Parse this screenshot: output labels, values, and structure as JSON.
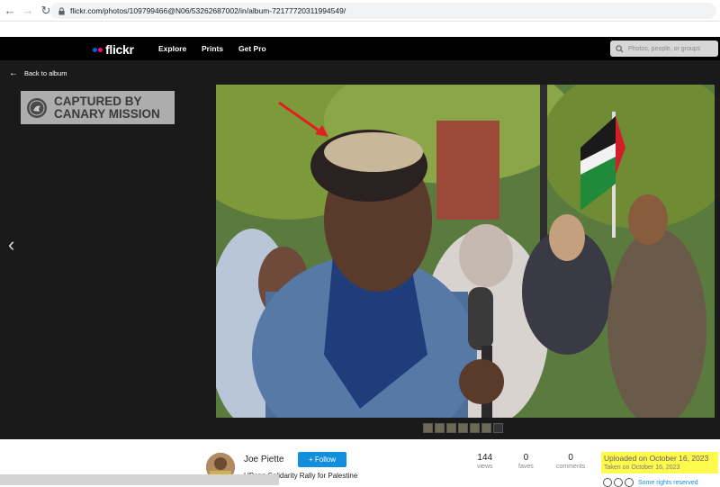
{
  "browser": {
    "url": "flickr.com/photos/109799466@N06/53262687002/in/album-72177720311994549/"
  },
  "nav": {
    "logo": "flickr",
    "links": [
      "Explore",
      "Prints",
      "Get Pro"
    ],
    "search_placeholder": "Photos, people, or groups"
  },
  "viewer": {
    "back_label": "Back to album",
    "watermark_line1": "CAPTURED BY",
    "watermark_line2": "CANARY MISSION"
  },
  "photo_info": {
    "owner": "Joe Piette",
    "follow_label": "+ Follow",
    "title": "UPenn Solidarity Rally for Palestine",
    "stats": [
      {
        "value": "144",
        "label": "views"
      },
      {
        "value": "0",
        "label": "faves"
      },
      {
        "value": "0",
        "label": "comments"
      }
    ],
    "uploaded": "Uploaded on October 16, 2023",
    "taken": "Taken on October 16, 2023",
    "rights": "Some rights reserved"
  },
  "colors": {
    "flickr_blue": "#0063dc",
    "flickr_pink": "#ff0084",
    "follow_blue": "#128fdc",
    "highlight": "#fff94d"
  }
}
